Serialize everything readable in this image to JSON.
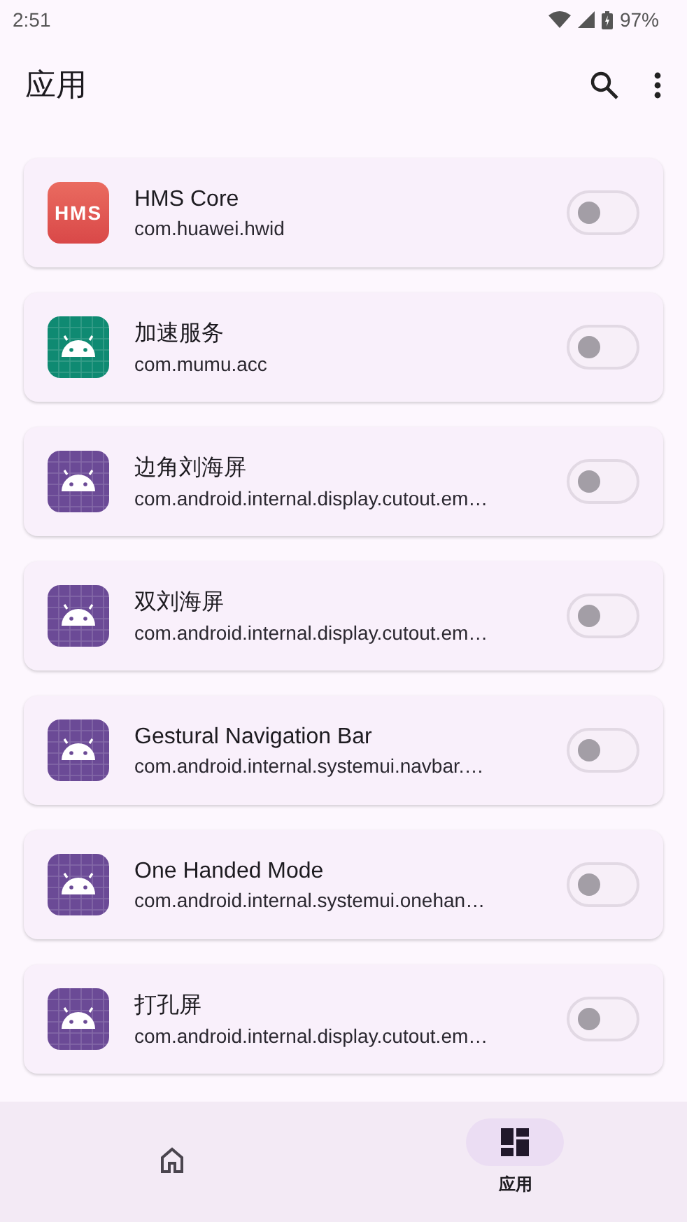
{
  "status_bar": {
    "time": "2:51",
    "battery": "97%"
  },
  "app_bar": {
    "title": "应用"
  },
  "apps": [
    {
      "name": "HMS Core",
      "package": "com.huawei.hwid",
      "icon": {
        "kind": "hms",
        "text": "HMS"
      },
      "on": false
    },
    {
      "name": "加速服务",
      "package": "com.mumu.acc",
      "icon": {
        "kind": "android",
        "color": "#0f8a72"
      },
      "on": false
    },
    {
      "name": "边角刘海屏",
      "package": "com.android.internal.display.cutout.em…",
      "icon": {
        "kind": "android",
        "color": "#6b4a96"
      },
      "on": false
    },
    {
      "name": "双刘海屏",
      "package": "com.android.internal.display.cutout.em…",
      "icon": {
        "kind": "android",
        "color": "#6b4a96"
      },
      "on": false
    },
    {
      "name": "Gestural Navigation Bar",
      "package": "com.android.internal.systemui.navbar.…",
      "icon": {
        "kind": "android",
        "color": "#6b4a96"
      },
      "on": false
    },
    {
      "name": "One Handed Mode",
      "package": "com.android.internal.systemui.onehan…",
      "icon": {
        "kind": "android",
        "color": "#6b4a96"
      },
      "on": false
    },
    {
      "name": "打孔屏",
      "package": "com.android.internal.display.cutout.em…",
      "icon": {
        "kind": "android",
        "color": "#6b4a96"
      },
      "on": false
    }
  ],
  "bottom_nav": [
    {
      "kind": "home",
      "selected": false
    },
    {
      "kind": "apps",
      "label": "应用",
      "selected": true
    }
  ]
}
